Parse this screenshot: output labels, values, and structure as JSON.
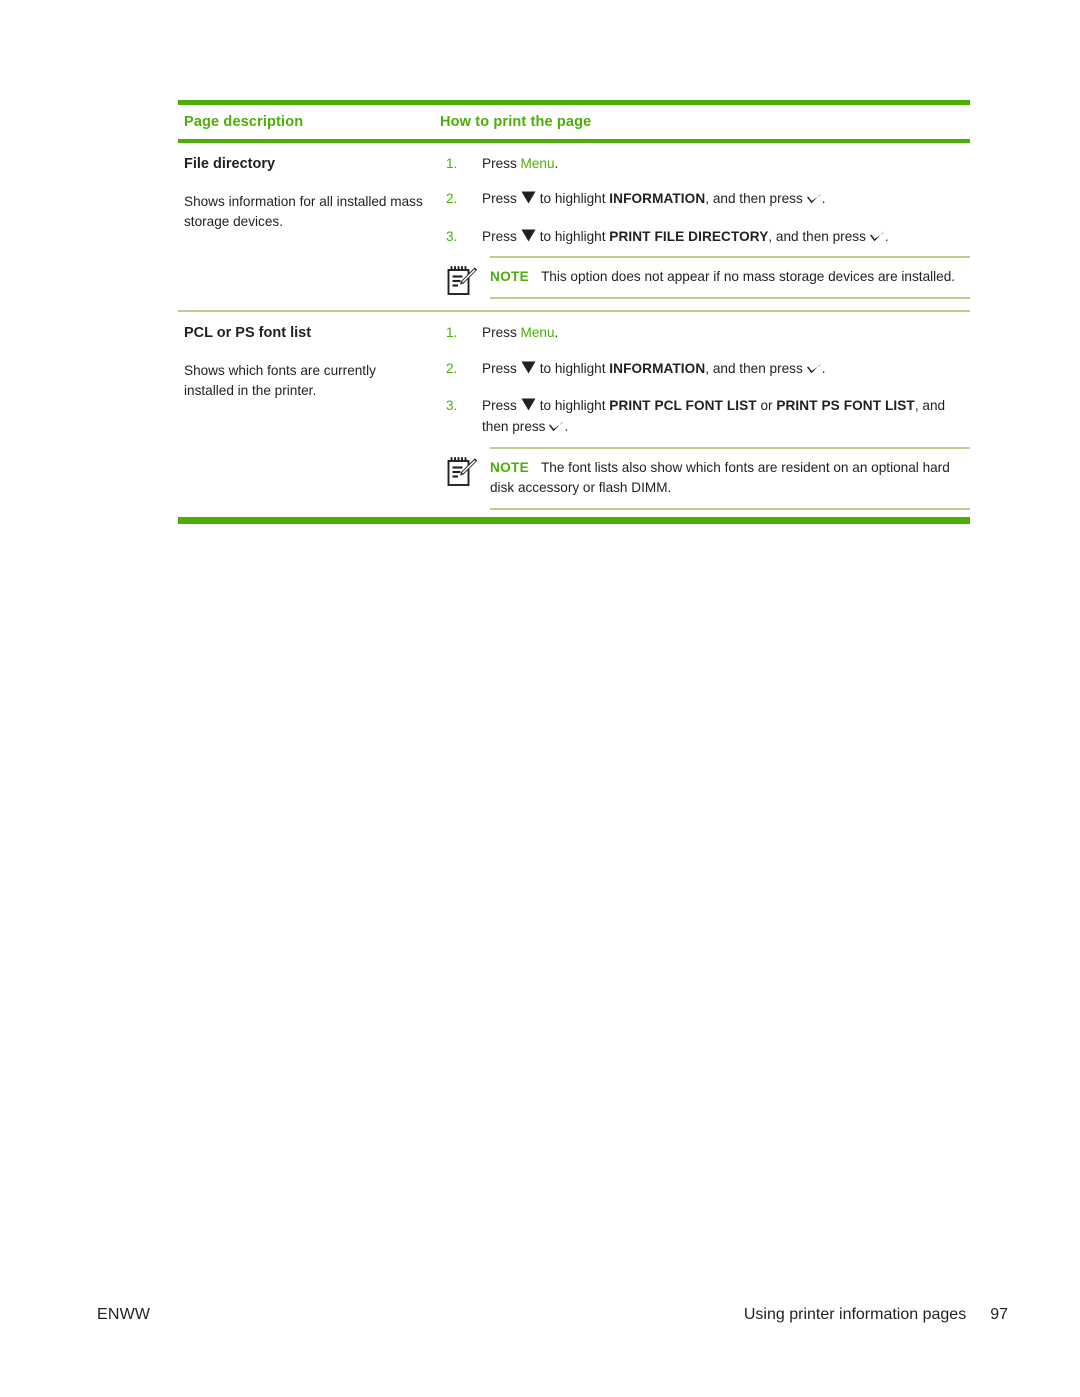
{
  "document": {
    "table": {
      "headers": {
        "col1": "Page description",
        "col2": "How to print the page"
      },
      "rows": [
        {
          "title": "File directory",
          "description": "Shows information for all installed mass storage devices.",
          "steps": [
            {
              "number": "1.",
              "prefix": "Press ",
              "menu": "Menu",
              "suffix": "."
            },
            {
              "number": "2.",
              "pre": "Press",
              "mid": "to highlight ",
              "strong": "INFORMATION",
              "post": ", and then press",
              "end": "."
            },
            {
              "number": "3.",
              "pre": "Press",
              "mid": "to highlight ",
              "strong": "PRINT FILE DIRECTORY",
              "post": ", and then press",
              "end": "."
            }
          ],
          "note": {
            "label": "NOTE",
            "text": "This option does not appear if no mass storage devices are installed."
          }
        },
        {
          "title": "PCL or PS font list",
          "description": "Shows which fonts are currently installed in the printer.",
          "steps": [
            {
              "number": "1.",
              "prefix": "Press ",
              "menu": "Menu",
              "suffix": "."
            },
            {
              "number": "2.",
              "pre": "Press",
              "mid": "to highlight ",
              "strong": "INFORMATION",
              "post": ", and then press",
              "end": "."
            },
            {
              "number": "3.",
              "pre": "Press",
              "mid": "to highlight ",
              "strong": "PRINT PCL FONT LIST",
              "conj": " or ",
              "strong2": "PRINT PS FONT LIST",
              "post": ", and then press",
              "end": "."
            }
          ],
          "note": {
            "label": "NOTE",
            "text": "The font lists also show which fonts are resident on an optional hard disk accessory or flash DIMM."
          }
        }
      ]
    },
    "footer": {
      "left": "ENWW",
      "section": "Using printer information pages",
      "page_number": "97"
    },
    "icons": {
      "down_arrow": "▼",
      "check_mark": "✓",
      "note": "notepad-pencil-icon"
    },
    "colors": {
      "accent_green": "#4CAE07",
      "light_green_rule": "#b9cf8f",
      "text": "#231f20"
    }
  }
}
